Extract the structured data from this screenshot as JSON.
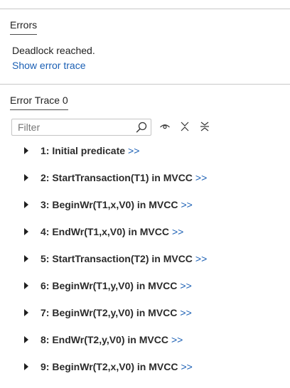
{
  "errors_section": {
    "title": "Errors",
    "message": "Deadlock reached.",
    "show_trace_link": "Show error trace"
  },
  "trace_section": {
    "title": "Error Trace 0",
    "filter": {
      "placeholder": "Filter",
      "value": ""
    },
    "toolbar_icons": [
      "eye-icon",
      "collapse-icon",
      "hide-vars-icon"
    ],
    "items": [
      {
        "label": "1: Initial predicate",
        "jump": ">>"
      },
      {
        "label": "2: StartTransaction(T1) in MVCC",
        "jump": ">>"
      },
      {
        "label": "3: BeginWr(T1,x,V0) in MVCC",
        "jump": ">>"
      },
      {
        "label": "4: EndWr(T1,x,V0) in MVCC",
        "jump": ">>"
      },
      {
        "label": "5: StartTransaction(T2) in MVCC",
        "jump": ">>"
      },
      {
        "label": "6: BeginWr(T1,y,V0) in MVCC",
        "jump": ">>"
      },
      {
        "label": "7: BeginWr(T2,y,V0) in MVCC",
        "jump": ">>"
      },
      {
        "label": "8: EndWr(T2,y,V0) in MVCC",
        "jump": ">>"
      },
      {
        "label": "9: BeginWr(T2,x,V0) in MVCC",
        "jump": ">>"
      }
    ]
  },
  "colors": {
    "link": "#1a5fb4",
    "text": "#1f1f1f",
    "divider": "#c8c8c8"
  }
}
